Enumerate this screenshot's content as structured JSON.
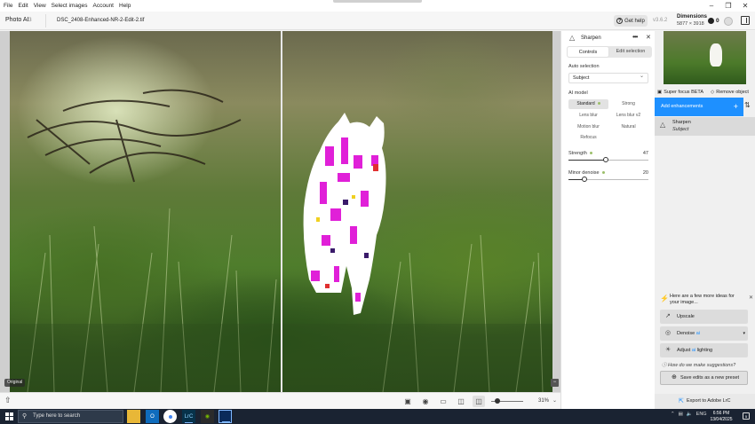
{
  "menu": {
    "items": [
      "File",
      "Edit",
      "View",
      "Select images",
      "Account",
      "Help"
    ]
  },
  "header": {
    "app_name": "Photo AI",
    "app_version": "3",
    "filename": "DSC_2408-Enhanced-NR-2-Edit-2.tif",
    "get_help": "Get help",
    "version": "v3.6.2",
    "dimensions_title": "Dimensions",
    "dimensions_value": "5877 × 3918",
    "token_count": "0"
  },
  "canvas": {
    "original_label": "Original",
    "zoom": "31%"
  },
  "controls": {
    "title": "Sharpen",
    "tabs": [
      "Controls",
      "Edit selection"
    ],
    "auto_selection_label": "Auto selection",
    "auto_selection_value": "Subject",
    "ai_model_label": "AI model",
    "models": [
      "Standard",
      "Strong",
      "Lens blur",
      "Lens blur v2",
      "Motion blur",
      "Natural",
      "Refocus"
    ],
    "selected_model": "Standard",
    "strength_label": "Strength",
    "strength_value": 47,
    "minor_denoise_label": "Minor denoise",
    "minor_denoise_value": 20
  },
  "right_panel": {
    "super_focus": "Super focus BETA",
    "remove_object": "Remove object",
    "add_enhancements": "Add enhancements",
    "enhancement_title": "Sharpen",
    "enhancement_subtitle": "Subject",
    "ideas_text": "Here are a few more ideas for your image...",
    "suggestions": {
      "upscale": "Upscale",
      "denoise_prefix": "Denoise ",
      "denoise_ai": "ai",
      "adjust_prefix": "Adjust ",
      "adjust_ai": "ai",
      "adjust_suffix": " lighting"
    },
    "how_suggestions": "How do we make suggestions?",
    "save_preset": "Save edits as a new preset",
    "export": "Export to Adobe LrC",
    "accent_color": "#1e90ff"
  },
  "taskbar": {
    "search_placeholder": "Type here to search",
    "tray_lang": "ENG",
    "time": "6:56 PM",
    "date": "13/04/2025",
    "notif_count": "5",
    "apps": [
      "file-explorer",
      "outlook",
      "lightroom-classic",
      "chrome",
      "nvidia",
      "photo-ai"
    ]
  }
}
